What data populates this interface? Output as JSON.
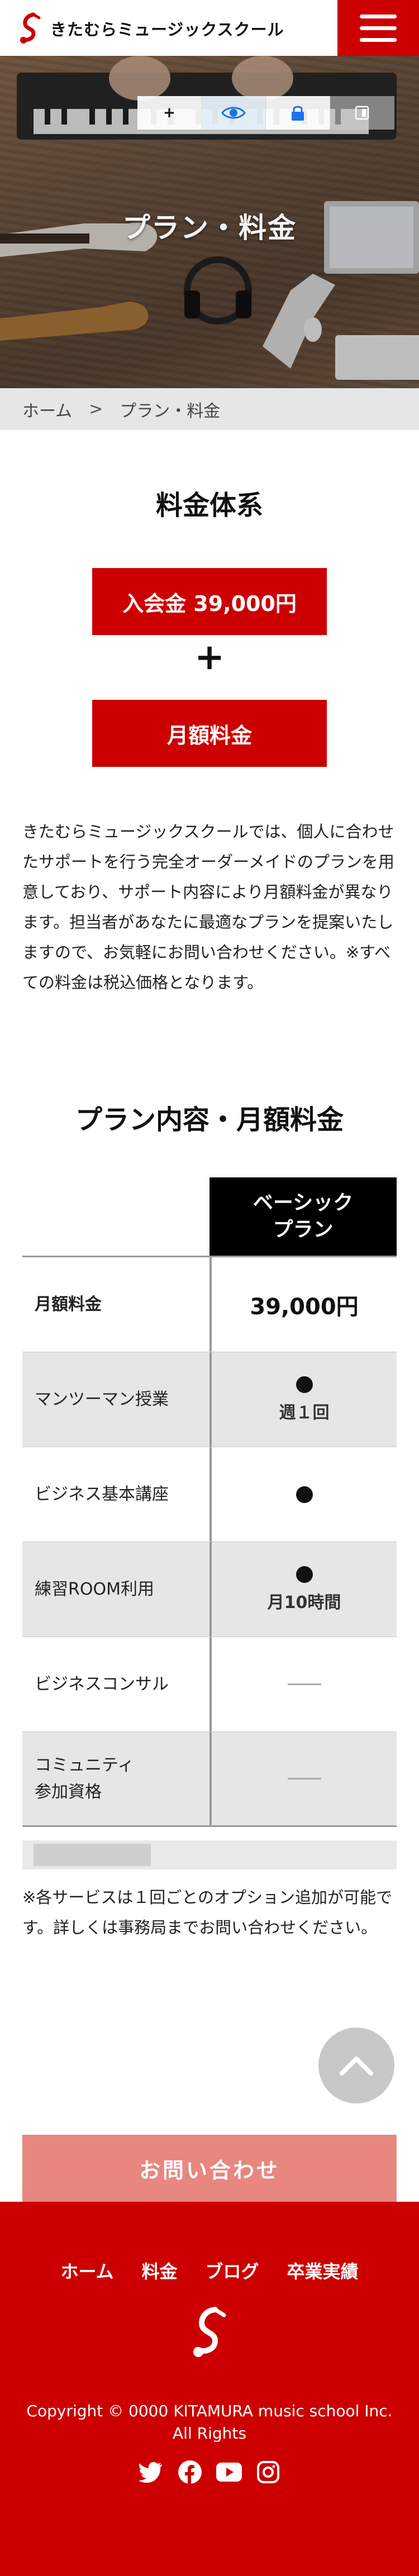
{
  "header": {
    "brand": "きたむらミュージックスクール",
    "menu_icon": "hamburger-menu-icon"
  },
  "hero": {
    "title": "プラン・料金",
    "toolbar": {
      "add": "+",
      "icons": [
        "plus-icon",
        "eye-icon",
        "lock-icon",
        "reader-icon"
      ]
    }
  },
  "breadcrumb": {
    "home": "ホーム",
    "separator": ">",
    "current": "プラン・料金"
  },
  "pricing": {
    "title": "料金体系",
    "entry_fee": "入会金 39,000円",
    "plus": "+",
    "monthly": "月額料金"
  },
  "description": "きたむらミュージックスクールでは、個人に合わせたサポートを行う完全オーダーメイドのプランを用意しており、サポート内容により月額料金が異なります。担当者があなたに最適なプランを提案いたしますので、お気軽にお問い合わせください。※すべての料金は税込価格となります。",
  "plan": {
    "title": "プラン内容・月額料金",
    "plan_name_line1": "ベーシック",
    "plan_name_line2": "プラン",
    "rows": [
      {
        "label": "月額料金",
        "price": "39,000円"
      },
      {
        "label": "マンツーマン授業",
        "sub": "週１回"
      },
      {
        "label": "ビジネス基本講座"
      },
      {
        "label": "練習ROOM利用",
        "sub": "月10時間"
      },
      {
        "label": "ビジネスコンサル"
      },
      {
        "label_line1": "コミュニティ",
        "label_line2": "参加資格"
      }
    ]
  },
  "note": "※各サービスは１回ごとのオプション追加が可能です。詳しくは事務局までお問い合わせください。",
  "contact_button": "お問い合わせ",
  "footer": {
    "nav": [
      "ホーム",
      "料金",
      "ブログ",
      "卒業実績"
    ],
    "copyright_line1": "Copyright © 0000 KITAMURA music school Inc.",
    "copyright_line2": "All Rights",
    "social": [
      "twitter-icon",
      "facebook-icon",
      "youtube-icon",
      "instagram-icon"
    ]
  },
  "colors": {
    "brand_red": "#cc0000",
    "contact_pink": "#e8877f",
    "breadcrumb_bg": "#e6e6e6"
  }
}
